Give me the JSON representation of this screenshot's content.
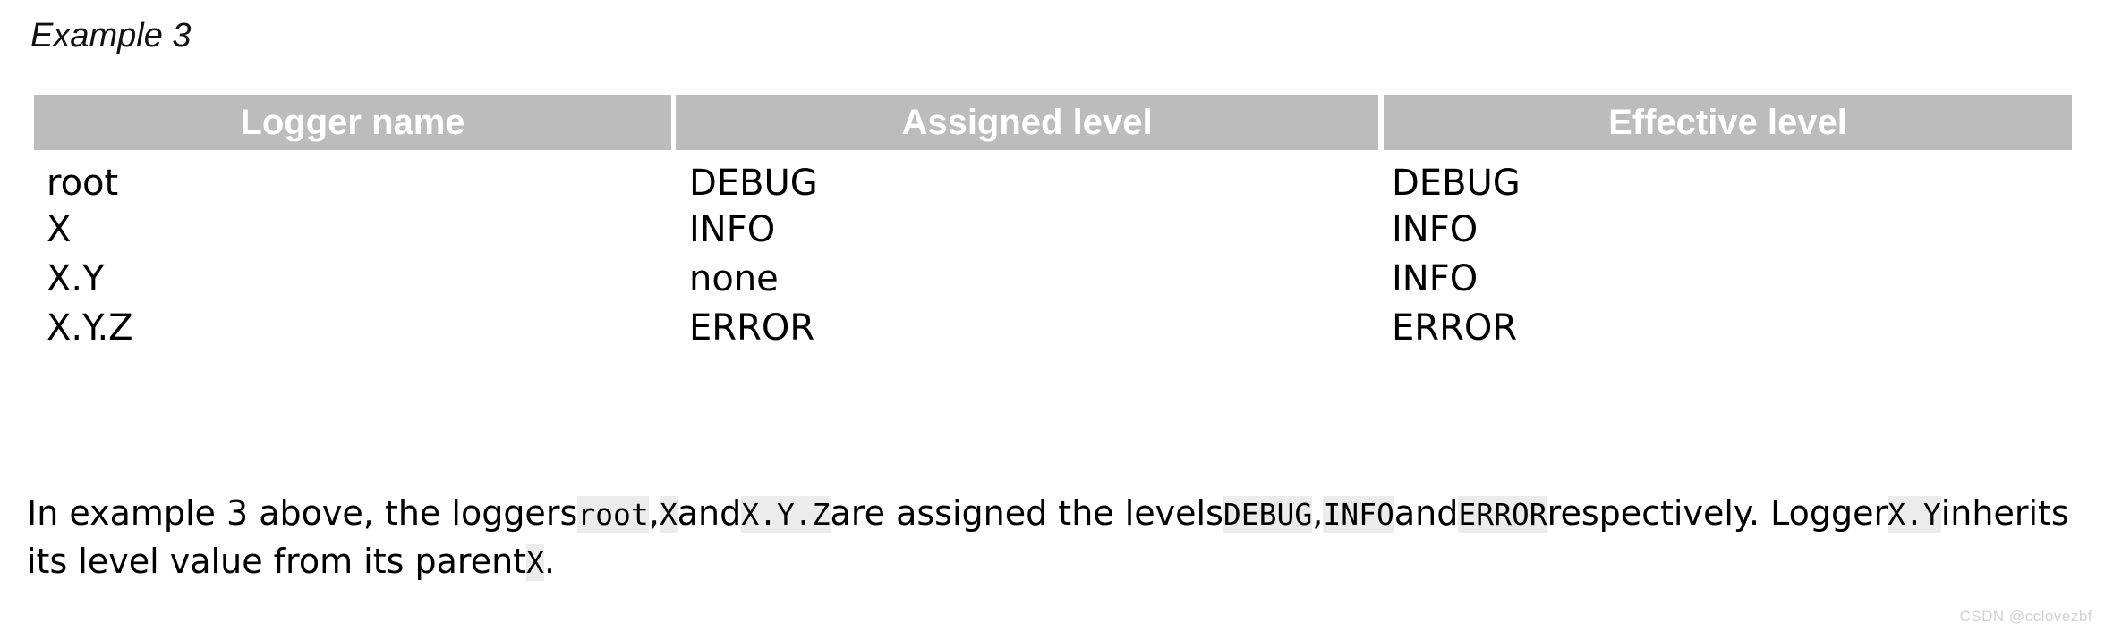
{
  "caption": "Example 3",
  "table": {
    "columns": [
      "Logger name",
      "Assigned level",
      "Effective level"
    ],
    "rows": [
      {
        "logger_name": "root",
        "assigned_level": "DEBUG",
        "effective_level": "DEBUG"
      },
      {
        "logger_name": "X",
        "assigned_level": "INFO",
        "effective_level": "INFO"
      },
      {
        "logger_name": "X.Y",
        "assigned_level": "none",
        "effective_level": "INFO"
      },
      {
        "logger_name": "X.Y.Z",
        "assigned_level": "ERROR",
        "effective_level": "ERROR"
      }
    ]
  },
  "explanation": {
    "t1": "In example 3 above, the loggers",
    "c1": "root",
    "t2": ",",
    "c2": "X",
    "t3": "and",
    "c3": "X.Y.Z",
    "t4": "are assigned the levels",
    "c4": "DEBUG",
    "t5": ",",
    "c5": "INFO",
    "t6": "and",
    "c6": "ERROR",
    "t7": "respectively. Logger",
    "c7": "X.Y",
    "t8": "inherits its level value from its parent",
    "c8": "X",
    "t9": "."
  },
  "watermark": "CSDN @cclovezbf",
  "colors": {
    "header_background": "#bcbcbc",
    "header_text": "#ffffff",
    "code_background": "#ececec",
    "page_background": "#ffffff",
    "watermark_text": "#d2d2d2"
  }
}
